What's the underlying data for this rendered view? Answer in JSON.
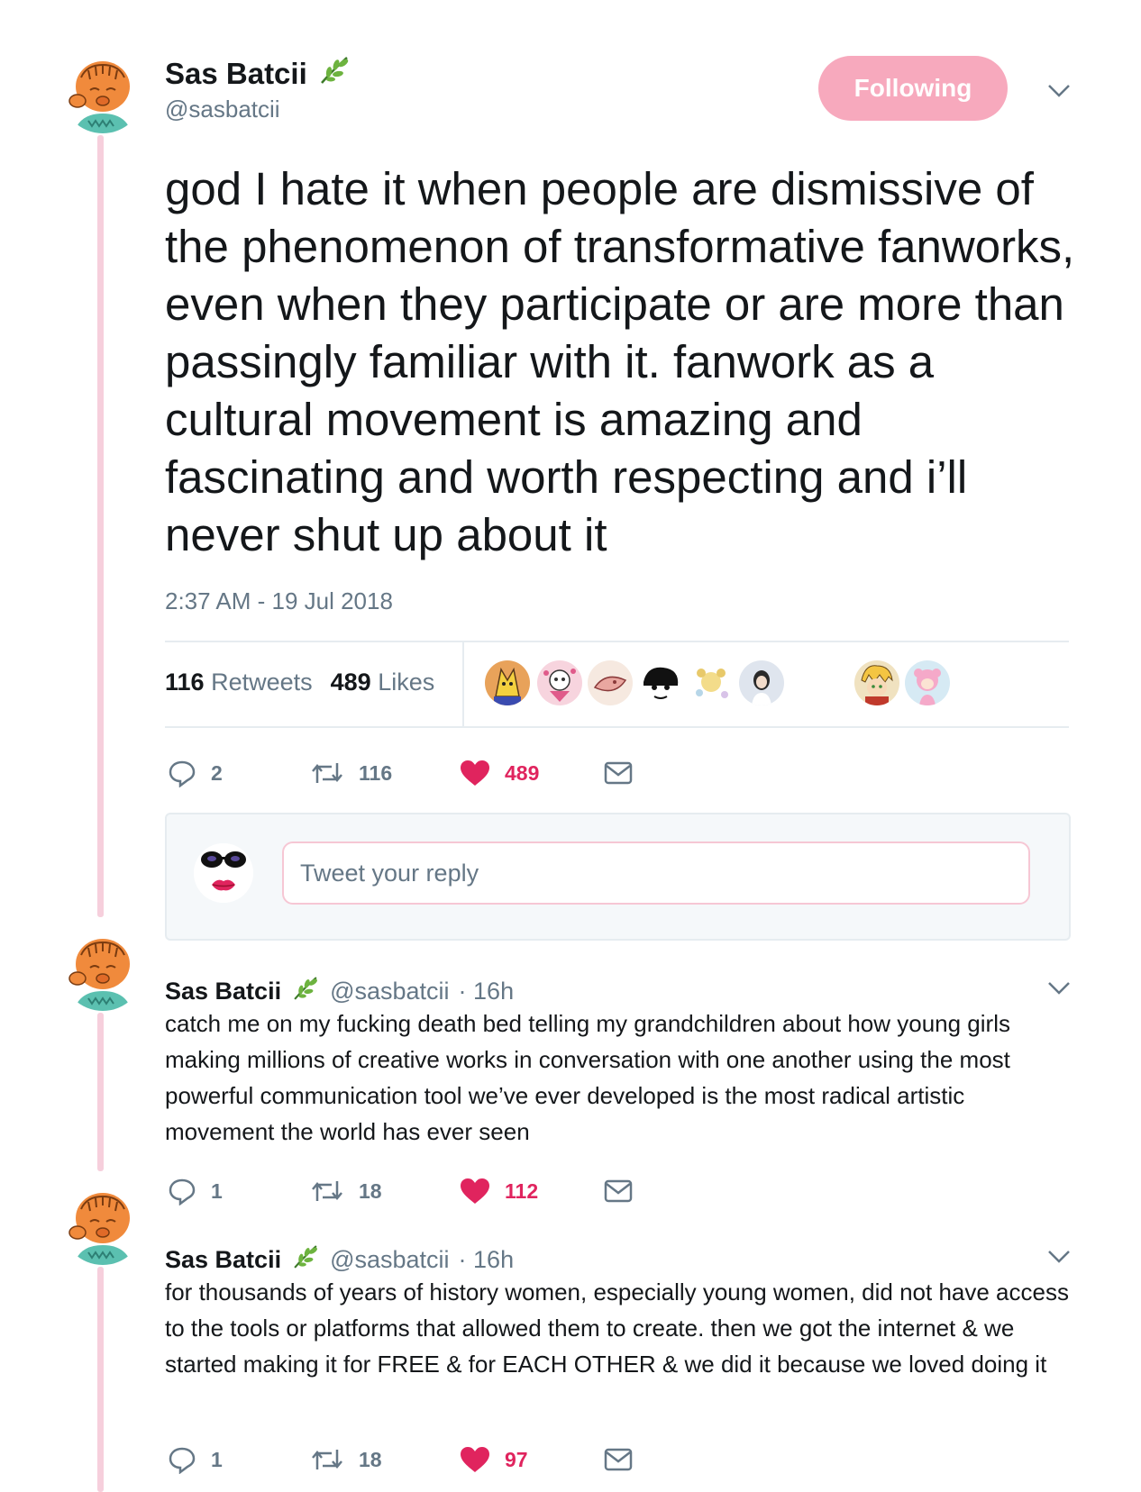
{
  "main_tweet": {
    "name": "Sas Batcii",
    "handle": "@sasbatcii",
    "follow_label": "Following",
    "text": "god I hate it when people are dismissive of the phenomenon of transformative fanworks, even when they participate or are more than passingly familiar with it. fanwork as a cultural movement is amazing and fascinating and worth respecting and i’ll never shut up about it",
    "timestamp": "2:37 AM - 19 Jul 2018",
    "retweet_count": "116",
    "retweet_label": "Retweets",
    "like_count": "489",
    "like_label": "Likes",
    "actions": {
      "replies": "2",
      "retweets": "116",
      "likes": "489"
    }
  },
  "reply_box": {
    "placeholder": "Tweet your reply"
  },
  "replies": [
    {
      "name": "Sas Batcii",
      "handle": "@sasbatcii",
      "time": "· 16h",
      "text": "catch me on my fucking death bed telling my grandchildren about how young girls making millions of creative works in conversation with one another using the most powerful communication tool we’ve ever developed is the most radical artistic movement the world has ever seen",
      "actions": {
        "replies": "1",
        "retweets": "18",
        "likes": "112"
      }
    },
    {
      "name": "Sas Batcii",
      "handle": "@sasbatcii",
      "time": "· 16h",
      "text": "for thousands of years of history women, especially young women, did not have access to the tools or platforms that allowed them to create. then we got the internet & we started making it for FREE & for EACH OTHER & we did it because we loved doing it",
      "actions": {
        "replies": "1",
        "retweets": "18",
        "likes": "97"
      }
    }
  ],
  "icons": [
    "leaf-icon",
    "chevron-down-icon",
    "reply-icon",
    "retweet-icon",
    "heart-icon",
    "message-icon"
  ],
  "colors": {
    "accent_pink": "#f7a9bd",
    "thread_line": "#f6cfdc",
    "like_red": "#e0245e",
    "muted": "#657786"
  }
}
